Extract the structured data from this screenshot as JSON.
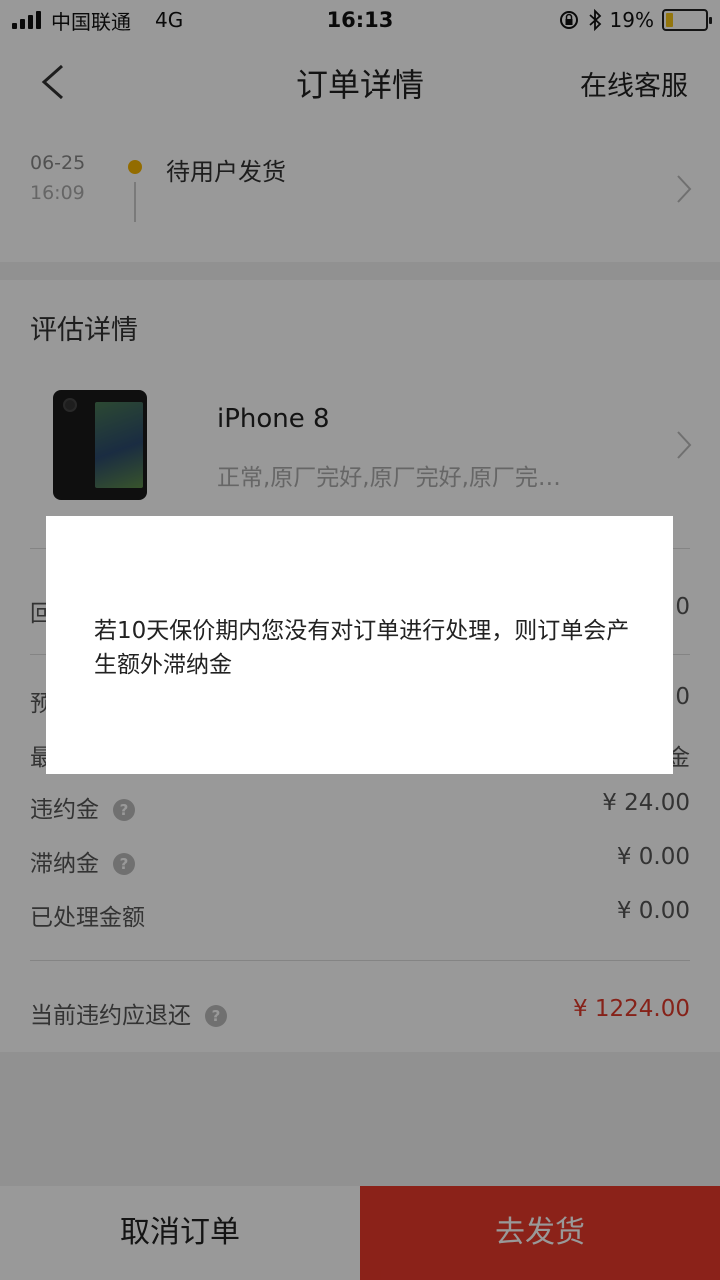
{
  "status_bar": {
    "carrier": "中国联通",
    "network": "4G",
    "time": "16:13",
    "battery": "19%",
    "battery_level": 0.19
  },
  "nav": {
    "title": "订单详情",
    "right_action": "在线客服"
  },
  "timeline": {
    "date": "06-25",
    "time": "16:09",
    "status": "待用户发货"
  },
  "evaluation": {
    "title": "评估详情",
    "product_name": "iPhone 8",
    "product_desc": "正常,原厂完好,原厂完好,原厂完…"
  },
  "partial_rows": {
    "row1_label": "回",
    "row1_value": "0",
    "row2_label": "预",
    "row2_value": "0",
    "row3_label": "最",
    "row3_value": "金"
  },
  "fees": [
    {
      "label": "违约金",
      "value": "¥ 24.00",
      "has_help": true
    },
    {
      "label": "滞纳金",
      "value": "¥ 0.00",
      "has_help": true
    },
    {
      "label": "已处理金额",
      "value": "¥ 0.00",
      "has_help": false
    }
  ],
  "refund": {
    "label": "当前违约应退还",
    "value": "¥ 1224.00"
  },
  "buttons": {
    "cancel": "取消订单",
    "ship": "去发货"
  },
  "dialog": {
    "message": "若10天保价期内您没有对订单进行处理，则订单会产生额外滞纳金"
  },
  "colors": {
    "accent": "#e8392b",
    "status_dot": "#f5b400",
    "battery": "#f5c518"
  }
}
